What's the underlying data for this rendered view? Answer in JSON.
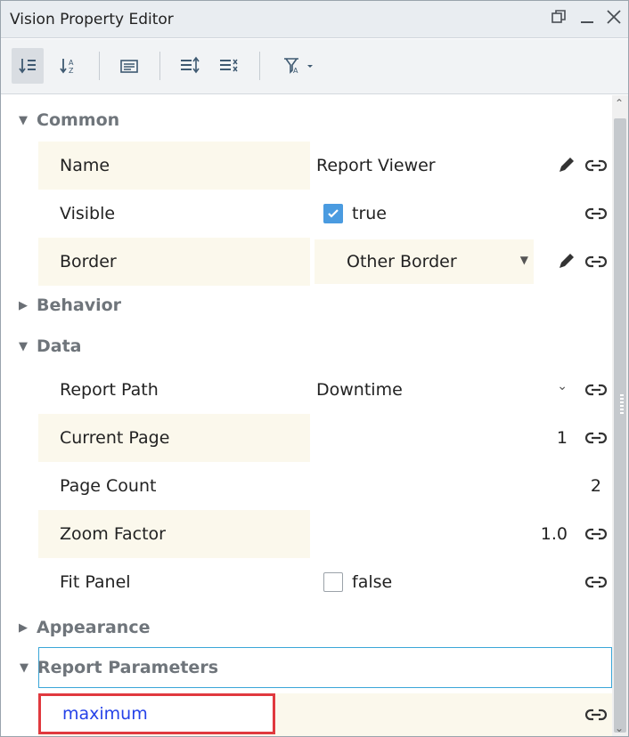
{
  "window": {
    "title": "Vision Property Editor",
    "restore_icon": "restore-icon",
    "minimize_icon": "minimize-icon",
    "close_icon": "close-icon"
  },
  "toolbar": {
    "buttons": [
      {
        "name": "categorized-sort-button",
        "icon": "category-sort-icon",
        "active": true
      },
      {
        "name": "alphabetical-sort-button",
        "icon": "alpha-sort-icon",
        "active": false
      },
      {
        "name": "description-panel-button",
        "icon": "description-icon",
        "active": false
      },
      {
        "name": "expand-all-button",
        "icon": "expand-all-icon",
        "active": false
      },
      {
        "name": "collapse-all-button",
        "icon": "collapse-all-icon",
        "active": false
      },
      {
        "name": "filter-button",
        "icon": "filter-icon",
        "active": false
      }
    ]
  },
  "sections": {
    "common": "Common",
    "behavior": "Behavior",
    "data": "Data",
    "appearance": "Appearance",
    "report_parameters": "Report Parameters"
  },
  "common": {
    "name_label": "Name",
    "name_value": "Report Viewer",
    "visible_label": "Visible",
    "visible_value": "true",
    "visible_checked": true,
    "border_label": "Border",
    "border_value": "Other Border"
  },
  "data": {
    "report_path_label": "Report Path",
    "report_path_value": "Downtime",
    "current_page_label": "Current Page",
    "current_page_value": "1",
    "page_count_label": "Page Count",
    "page_count_value": "2",
    "zoom_factor_label": "Zoom Factor",
    "zoom_factor_value": "1.0",
    "fit_panel_label": "Fit Panel",
    "fit_panel_value": "false",
    "fit_panel_checked": false
  },
  "report_parameters": {
    "param_name": "maximum"
  },
  "colors": {
    "accent": "#4a9be0",
    "highlight_border": "#e0393e",
    "param_text": "#2542e8",
    "section_selected_border": "#3aa6d8"
  }
}
